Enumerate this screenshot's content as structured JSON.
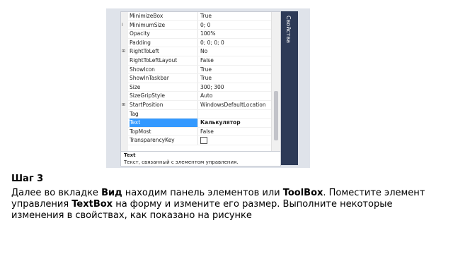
{
  "properties_panel": {
    "side_tab_label": "Свойства",
    "gutter_markers": [
      {
        "label": "I",
        "row": 1
      },
      {
        "label": "⊞",
        "row": 4
      },
      {
        "label": "⊞",
        "row": 10
      }
    ],
    "rows": [
      {
        "name": "MinimizeBox",
        "value": "True"
      },
      {
        "name": "MinimumSize",
        "value": "0; 0"
      },
      {
        "name": "Opacity",
        "value": "100%"
      },
      {
        "name": "Padding",
        "value": "0; 0; 0; 0"
      },
      {
        "name": "RightToLeft",
        "value": "No"
      },
      {
        "name": "RightToLeftLayout",
        "value": "False"
      },
      {
        "name": "ShowIcon",
        "value": "True"
      },
      {
        "name": "ShowInTaskbar",
        "value": "True"
      },
      {
        "name": "Size",
        "value": "300; 300"
      },
      {
        "name": "SizeGripStyle",
        "value": "Auto"
      },
      {
        "name": "StartPosition",
        "value": "WindowsDefaultLocation"
      },
      {
        "name": "Tag",
        "value": ""
      },
      {
        "name": "Text",
        "value": "Калькулятор",
        "selected": true
      },
      {
        "name": "TopMost",
        "value": "False"
      },
      {
        "name": "TransparencyKey",
        "value": "",
        "checkbox": true
      }
    ],
    "description_title": "Text",
    "description_text": "Текст, связанный с элементом управления."
  },
  "instructions": {
    "step_title": "Шаг 3",
    "paragraph": [
      {
        "text": "Далее во вкладке ",
        "bold": false
      },
      {
        "text": "Вид",
        "bold": true
      },
      {
        "text": " находим панель элементов или ",
        "bold": false
      },
      {
        "text": "ToolBox",
        "bold": true
      },
      {
        "text": ". Поместите элемент управления ",
        "bold": false
      },
      {
        "text": "TextBox",
        "bold": true
      },
      {
        "text": " на форму и измените его размер. Выполните некоторые изменения в свойствах, как показано на рисунке",
        "bold": false
      }
    ]
  }
}
